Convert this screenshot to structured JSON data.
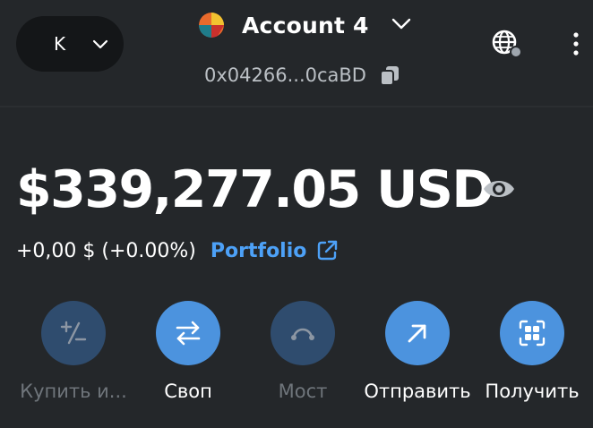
{
  "network": {
    "letter": "K"
  },
  "account": {
    "name": "Account 4",
    "address": "0x04266...0caBD"
  },
  "balance": {
    "amount": "$339,277.05 USD"
  },
  "change": {
    "text": "+0,00 $ (+0.00%)",
    "portfolio_label": "Portfolio"
  },
  "actions": [
    {
      "label": "Купить и...",
      "icon": "buy-sell-icon",
      "enabled": false
    },
    {
      "label": "Своп",
      "icon": "swap-icon",
      "enabled": true
    },
    {
      "label": "Мост",
      "icon": "bridge-icon",
      "enabled": false
    },
    {
      "label": "Отправить",
      "icon": "send-arrow-icon",
      "enabled": true
    },
    {
      "label": "Получить",
      "icon": "qr-code-icon",
      "enabled": true
    }
  ],
  "colors": {
    "background": "#24272a",
    "accent": "#4c93de",
    "link": "#4da1f7",
    "disabled_circle": "#2f4c6e",
    "muted_text": "#bbc0c5"
  }
}
